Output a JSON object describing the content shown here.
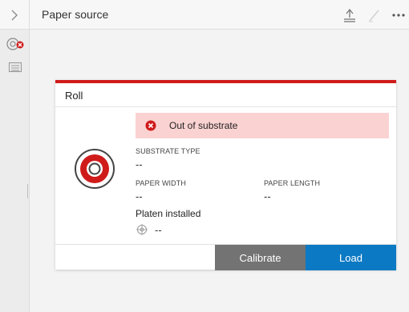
{
  "header": {
    "title": "Paper source",
    "icons": [
      "chevron-right-icon",
      "eject-icon",
      "pen-icon",
      "more-icon"
    ]
  },
  "sidebar": {
    "items": [
      {
        "icon": "roll-error-icon"
      },
      {
        "icon": "sheet-tray-icon"
      }
    ]
  },
  "card": {
    "title": "Roll",
    "alert": {
      "text": "Out of substrate",
      "color": "#d01b1b"
    },
    "substrate_type_label": "SUBSTRATE TYPE",
    "substrate_type_value": "--",
    "paper_width_label": "PAPER WIDTH",
    "paper_width_value": "--",
    "paper_length_label": "PAPER LENGTH",
    "paper_length_value": "--",
    "platen_label": "Platen installed",
    "platen_value": "--"
  },
  "actions": {
    "calibrate_label": "Calibrate",
    "load_label": "Load"
  },
  "colors": {
    "accent_red": "#d01b1b",
    "load_blue": "#0b79c3",
    "calibrate_gray": "#737373"
  }
}
